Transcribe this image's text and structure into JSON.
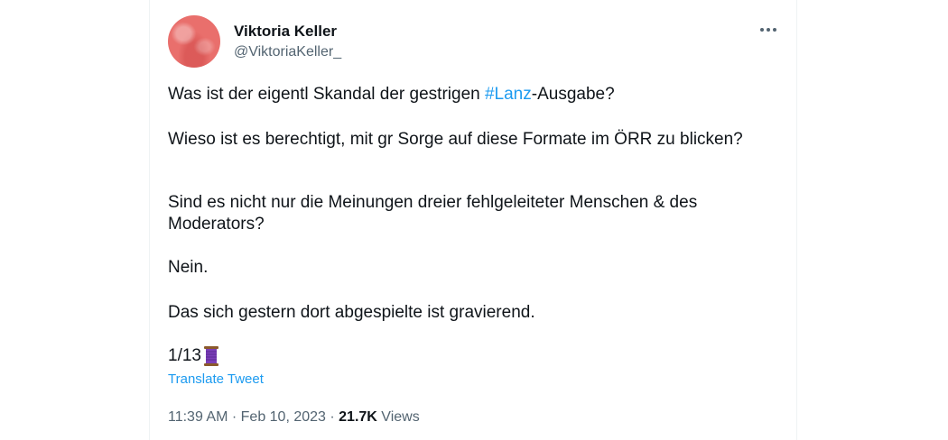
{
  "author": {
    "name": "Viktoria Keller",
    "handle": "@ViktoriaKeller_"
  },
  "tweet": {
    "line1_before": "Was ist der eigentl Skandal der gestrigen ",
    "line1_hashtag": "#Lanz",
    "line1_after": "-Ausgabe?",
    "para2": "Wieso ist es berechtigt, mit gr Sorge auf diese Formate im ÖRR zu blicken?",
    "para3": "Sind es nicht nur die Meinungen dreier fehlgeleiteter Menschen & des Moderators?",
    "para4": "Nein.",
    "para5": "Das sich gestern dort abgespielte ist gravierend.",
    "counter": "1/13",
    "thread_icon": "thread-spool-icon"
  },
  "translate_label": "Translate Tweet",
  "meta": {
    "time": "11:39 AM",
    "separator": " · ",
    "date": "Feb 10, 2023",
    "views_count": "21.7K",
    "views_label": " Views"
  },
  "colors": {
    "accent": "#1d9bf0",
    "text": "#0f1419",
    "muted": "#536471"
  }
}
